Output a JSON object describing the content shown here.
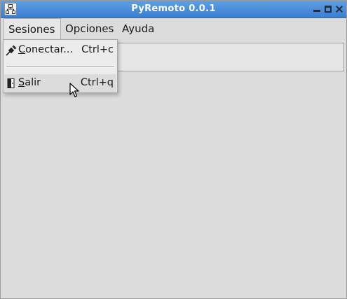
{
  "window": {
    "title": "PyRemoto 0.0.1"
  },
  "icons": {
    "app": "network-icon",
    "conectar": "plug-icon",
    "salir": "door-exit-icon"
  },
  "menubar": {
    "items": [
      {
        "label": "Sesiones"
      },
      {
        "label": "Opciones"
      },
      {
        "label": "Ayuda"
      }
    ]
  },
  "dropdown": {
    "items": [
      {
        "label_mnemonic": "C",
        "label_rest": "onectar...",
        "shortcut": "Ctrl+c"
      },
      {
        "label_mnemonic": "S",
        "label_rest": "alir",
        "shortcut": "Ctrl+q"
      }
    ]
  },
  "colors": {
    "titlebar": "#3b7fd0",
    "window_bg": "#dcdcdc",
    "menu_bg": "#ececec"
  }
}
